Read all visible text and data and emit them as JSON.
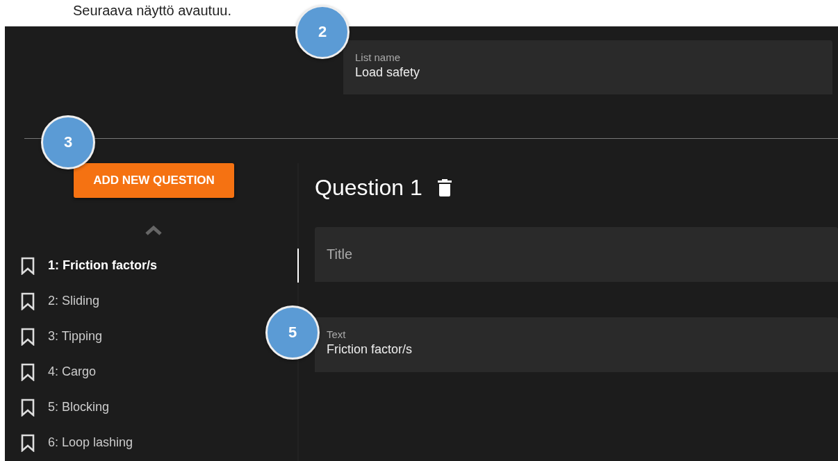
{
  "caption": "Seuraava näyttö avautuu.",
  "list_name": {
    "label": "List name",
    "value": "Load safety"
  },
  "add_button": "ADD NEW QUESTION",
  "questions": [
    {
      "label": "1: Friction factor/s",
      "selected": true
    },
    {
      "label": "2: Sliding",
      "selected": false
    },
    {
      "label": "3: Tipping",
      "selected": false
    },
    {
      "label": "4: Cargo",
      "selected": false
    },
    {
      "label": "5: Blocking",
      "selected": false
    },
    {
      "label": "6: Loop lashing",
      "selected": false
    }
  ],
  "editor": {
    "heading": "Question 1",
    "title_field": {
      "placeholder": "Title"
    },
    "text_field": {
      "label": "Text",
      "value": "Friction factor/s"
    }
  },
  "callouts": [
    "2",
    "3",
    "5"
  ]
}
